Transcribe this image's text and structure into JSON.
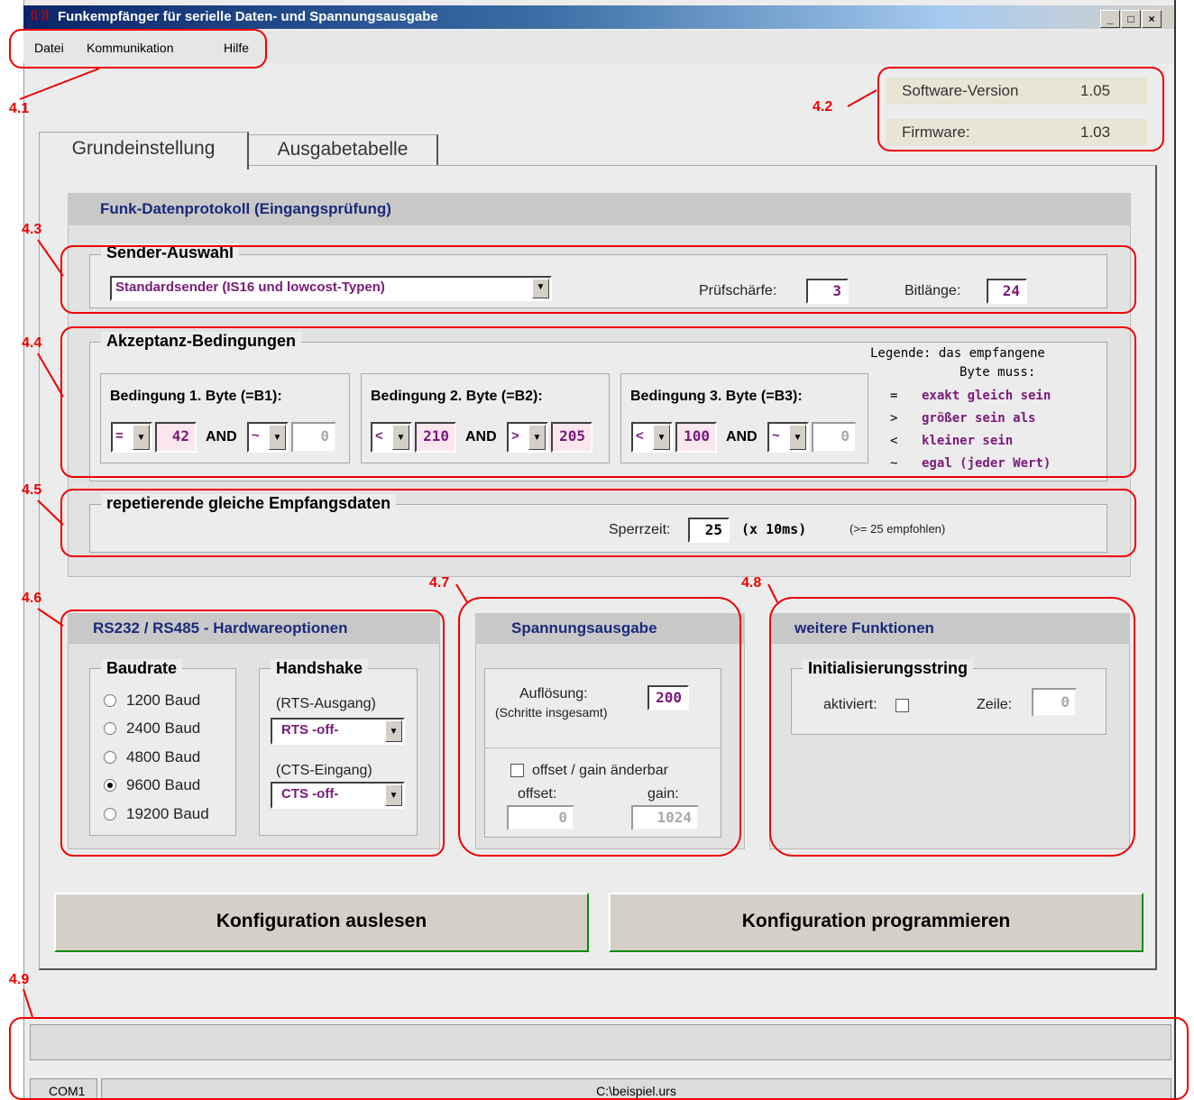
{
  "window": {
    "title": "Funkempfänger für serielle Daten- und Spannungsausgabe",
    "buttons": [
      "_",
      "□",
      "×"
    ]
  },
  "menu": {
    "items": [
      "Datei",
      "Kommunikation",
      "Hilfe"
    ]
  },
  "version": {
    "software_label": "Software-Version",
    "software_value": "1.05",
    "firmware_label": "Firmware:",
    "firmware_value": "1.03"
  },
  "tabs": [
    {
      "label": "Grundeinstellung",
      "active": true
    },
    {
      "label": "Ausgabetabelle",
      "active": false
    }
  ],
  "protocol": {
    "header": "Funk-Datenprotokoll (Eingangsprüfung)",
    "sender": {
      "title": "Sender-Auswahl",
      "selected": "Standardsender (IS16 und lowcost-Typen)",
      "pruef_label": "Prüfschärfe:",
      "pruef_value": "3",
      "bit_label": "Bitlänge:",
      "bit_value": "24"
    },
    "akzeptanz": {
      "title": "Akzeptanz-Bedingungen",
      "and_label": "AND",
      "conditions": [
        {
          "label": "Bedingung 1. Byte (=B1):",
          "op1": "=",
          "val1": "42",
          "op2": "~",
          "val2": "0"
        },
        {
          "label": "Bedingung 2. Byte (=B2):",
          "op1": "<",
          "val1": "210",
          "op2": ">",
          "val2": "205"
        },
        {
          "label": "Bedingung 3. Byte (=B3):",
          "op1": "<",
          "val1": "100",
          "op2": "~",
          "val2": "0"
        }
      ],
      "legend": {
        "title1": "Legende: das empfangene",
        "title2": "Byte muss:",
        "rows": [
          {
            "sym": "=",
            "text": "exakt gleich sein"
          },
          {
            "sym": ">",
            "text": "größer sein als"
          },
          {
            "sym": "<",
            "text": "kleiner sein"
          },
          {
            "sym": "~",
            "text": "egal (jeder Wert)"
          }
        ]
      }
    },
    "repeat": {
      "title": "repetierende gleiche Empfangsdaten",
      "sperr_label": "Sperrzeit:",
      "sperr_value": "25",
      "unit": "(x 10ms)",
      "hint": "(>= 25 empfohlen)"
    }
  },
  "hardware": {
    "header": "RS232 / RS485 - Hardwareoptionen",
    "baud_title": "Baudrate",
    "bauds": [
      {
        "label": "1200 Baud",
        "selected": false
      },
      {
        "label": "2400 Baud",
        "selected": false
      },
      {
        "label": "4800 Baud",
        "selected": false
      },
      {
        "label": "9600 Baud",
        "selected": true
      },
      {
        "label": "19200 Baud",
        "selected": false
      }
    ],
    "hs_title": "Handshake",
    "rts_label": "(RTS-Ausgang)",
    "rts_value": "RTS -off-",
    "cts_label": "(CTS-Eingang)",
    "cts_value": "CTS -off-"
  },
  "voltage": {
    "header": "Spannungsausgabe",
    "aufl_label": "Auflösung:",
    "aufl_sub": "(Schritte insgesamt)",
    "aufl_value": "200",
    "offset_check_label": "offset / gain änderbar",
    "offset_label": "offset:",
    "offset_value": "0",
    "gain_label": "gain:",
    "gain_value": "1024"
  },
  "weitere": {
    "header": "weitere Funktionen",
    "init_title": "Initialisierungsstring",
    "aktiv_label": "aktiviert:",
    "zeile_label": "Zeile:",
    "zeile_value": "0"
  },
  "buttons": {
    "read": "Konfiguration auslesen",
    "program": "Konfiguration programmieren"
  },
  "statusbar": {
    "port": "COM1",
    "file": "C:\\beispiel.urs"
  },
  "annotations": [
    "4.1",
    "4.2",
    "4.3",
    "4.4",
    "4.5",
    "4.6",
    "4.7",
    "4.8",
    "4.9"
  ],
  "colors": {
    "annotation": "#e00000",
    "value_text": "#7a1a7a",
    "header_text": "#1a2a7a"
  }
}
